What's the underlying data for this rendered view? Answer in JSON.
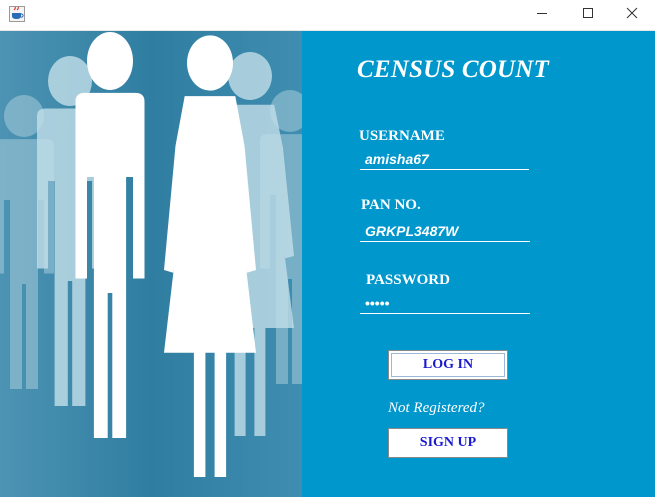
{
  "window": {
    "icon": "java-coffee-icon",
    "controls": {
      "minimize": "minimize-icon",
      "maximize": "maximize-icon",
      "close": "close-icon"
    }
  },
  "login": {
    "title": "CENSUS COUNT",
    "username_label": "USERNAME",
    "username_value": "amisha67",
    "pan_label": "PAN NO.",
    "pan_value": "GRKPL3487W",
    "password_label": "PASSWORD",
    "password_value": "•••••",
    "login_button": "LOG IN",
    "not_registered": "Not Registered?",
    "signup_button": "SIGN UP"
  },
  "colors": {
    "panel_bg": "#0097cc",
    "image_bg": "#3a88a8",
    "button_text": "#1a1ad0"
  }
}
